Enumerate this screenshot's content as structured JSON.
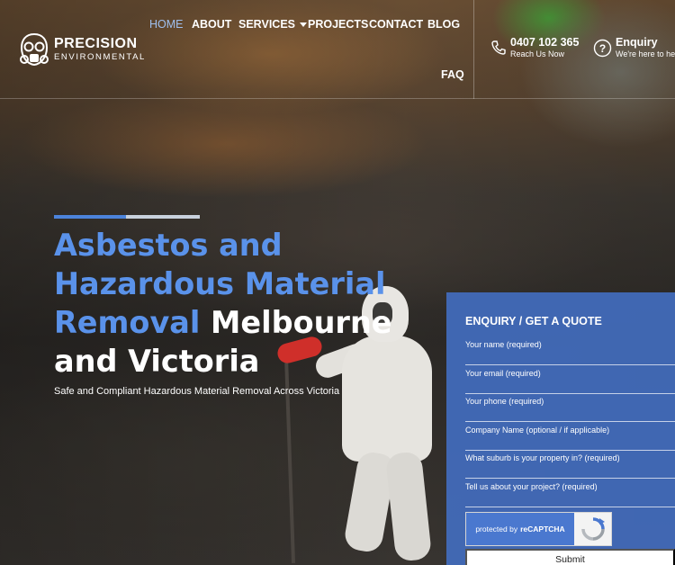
{
  "brand": {
    "name": "PRECISION",
    "subtitle": "ENVIRONMENTAL"
  },
  "nav": {
    "items": [
      {
        "label": "HOME",
        "active": true
      },
      {
        "label": "ABOUT"
      },
      {
        "label": "SERVICES",
        "has_dropdown": true
      },
      {
        "label": "PROJECTS"
      },
      {
        "label": "CONTACT"
      },
      {
        "label": "BLOG"
      },
      {
        "label": "FAQ"
      }
    ]
  },
  "contact": {
    "phone": "0407 102 365",
    "phone_sub": "Reach Us Now",
    "enquiry": "Enquiry",
    "enquiry_sub": "We're here to help"
  },
  "hero": {
    "title_highlight": "Asbestos and Hazardous Material Removal",
    "title_rest": "Melbourne and Victoria",
    "subtitle": "Safe and Compliant Hazardous Material Removal Across Victoria",
    "accent_color": "#5a92ea"
  },
  "form": {
    "title": "ENQUIRY / GET A QUOTE",
    "fields": [
      {
        "label": "Your name (required)"
      },
      {
        "label": "Your email (required)"
      },
      {
        "label": "Your phone (required)"
      },
      {
        "label": "Company Name (optional / if applicable)"
      },
      {
        "label": "What suburb is your property in? (required)"
      },
      {
        "label": "Tell us about your project? (required)"
      }
    ],
    "captcha_text": "protected by",
    "captcha_brand": "reCAPTCHA",
    "submit_label": "Submit",
    "panel_color": "#426cbe"
  }
}
